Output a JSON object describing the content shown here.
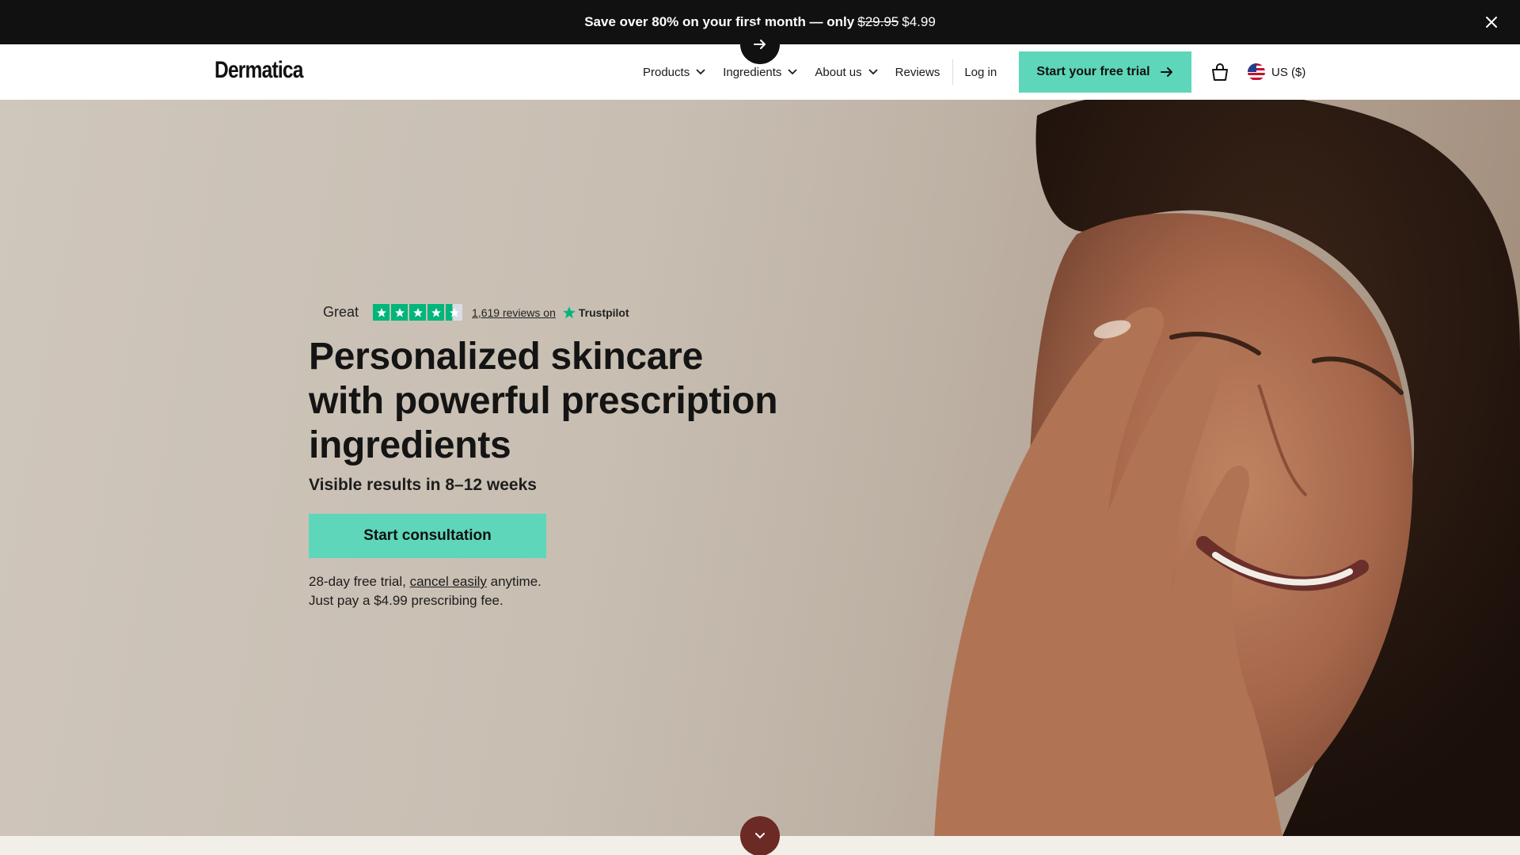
{
  "promo": {
    "text_lead": "Save over 80% on your first month — only",
    "old_price": "$29.95",
    "new_price": "$4.99",
    "close_icon": "close-icon",
    "arrow_icon": "arrow-right-icon"
  },
  "nav": {
    "logo": "Dermatica",
    "links": [
      {
        "label": "Products",
        "icon": "chevron-down-icon"
      },
      {
        "label": "Ingredients",
        "icon": "chevron-down-icon"
      },
      {
        "label": "About us",
        "icon": "chevron-down-icon"
      },
      {
        "label": "Reviews"
      }
    ],
    "login": "Log in",
    "cta": "Start your free trial",
    "cart_icon": "shopping-bag-icon",
    "locale": "US ($)"
  },
  "hero": {
    "rating_word": "Great",
    "stars": 4.5,
    "reviews_text": "1,619 reviews on",
    "platform": "Trustpilot",
    "headline": "Personalized skincare with powerful prescription ingredients",
    "subheadline": "Visible results in 8–12 weeks",
    "cta": "Start consultation",
    "fine_1_pre": "28-day free trial,",
    "fine_1_link": "cancel easily",
    "fine_1_post": "anytime.",
    "fine_2": "Just pay a $4.99 prescribing fee."
  },
  "colors": {
    "accent": "#5ed6b9",
    "dark": "#111111",
    "scroll_button": "#6b2a24",
    "trustpilot_green": "#00b67a"
  }
}
